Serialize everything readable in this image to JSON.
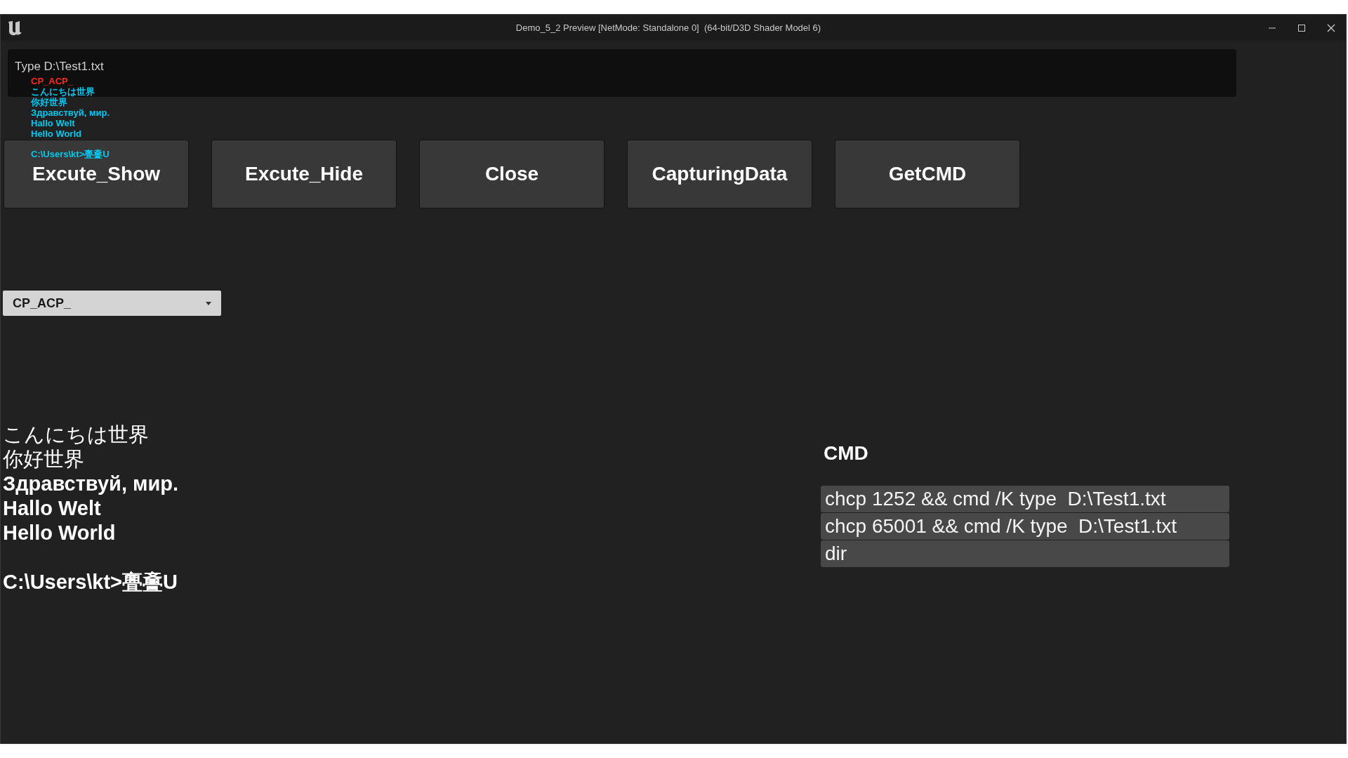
{
  "window": {
    "title": "Demo_5_2 Preview [NetMode: Standalone 0]  (64-bit/D3D Shader Model 6)"
  },
  "input": {
    "placeholder": "Type D:\\Test1.txt"
  },
  "debug_log": [
    {
      "text": "CP_ACP_",
      "color": "#ff2a1a"
    },
    {
      "text": "こんにちは世界",
      "color": "#00c8f0"
    },
    {
      "text": "你好世界",
      "color": "#00c8f0"
    },
    {
      "text": "Здравствуй, мир.",
      "color": "#00c8f0"
    },
    {
      "text": "Hallo Welt",
      "color": "#00c8f0"
    },
    {
      "text": "Hello World",
      "color": "#00c8f0"
    },
    {
      "text": "C:\\Users\\kt>亹斖U",
      "color": "#00c8f0"
    }
  ],
  "buttons": [
    "Excute_Show",
    "Excute_Hide",
    "Close",
    "CapturingData",
    "GetCMD"
  ],
  "dropdown": {
    "value": "CP_ACP_"
  },
  "output_lines": [
    {
      "text": "こんにちは世界",
      "kind": "plain"
    },
    {
      "text": "你好世界",
      "kind": "plain"
    },
    {
      "text": "Здравствуй, мир.",
      "kind": "bold"
    },
    {
      "text": "Hallo Welt",
      "kind": "bold"
    },
    {
      "text": "Hello World",
      "kind": "bold"
    },
    {
      "text": "C:\\Users\\kt>亹斖U",
      "kind": "prompt"
    }
  ],
  "cmd": {
    "label": "CMD",
    "commands": [
      "chcp 1252 && cmd /K type  D:\\Test1.txt",
      "chcp 65001 && cmd /K type  D:\\Test1.txt",
      "dir"
    ]
  }
}
